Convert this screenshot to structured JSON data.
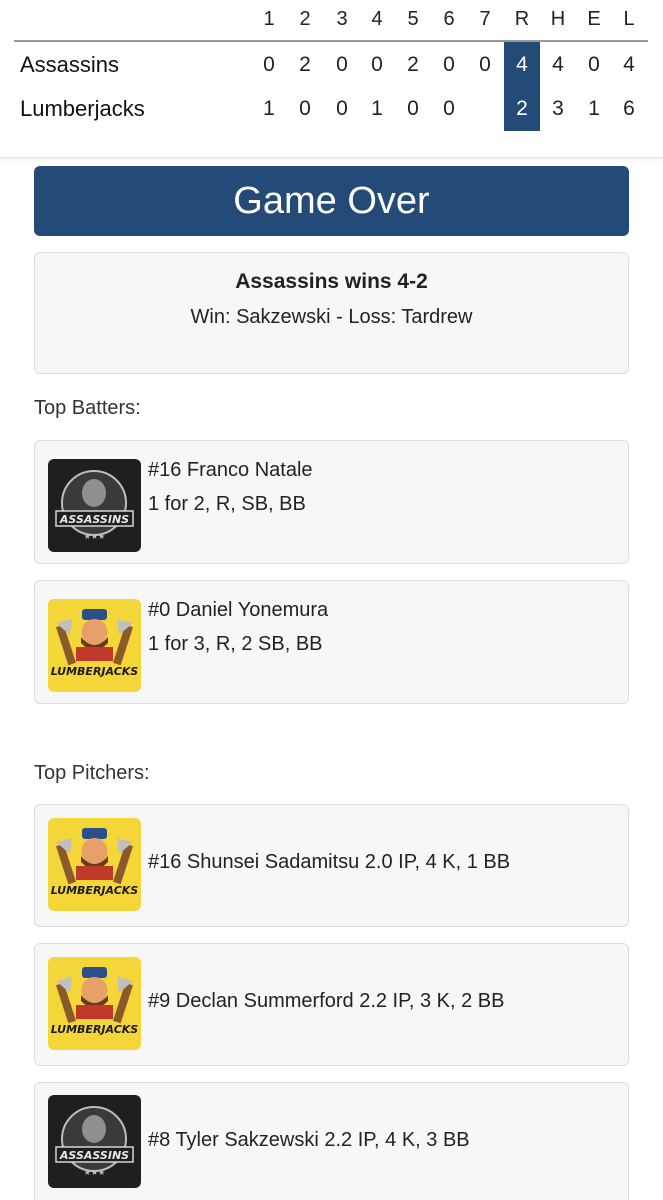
{
  "scoreboard": {
    "headers": [
      "1",
      "2",
      "3",
      "4",
      "5",
      "6",
      "7",
      "R",
      "H",
      "E",
      "L"
    ],
    "teams": [
      {
        "name": "Assassins",
        "cells": [
          "0",
          "2",
          "0",
          "0",
          "2",
          "0",
          "0",
          "4",
          "4",
          "0",
          "4"
        ]
      },
      {
        "name": "Lumberjacks",
        "cells": [
          "1",
          "0",
          "0",
          "1",
          "0",
          "0",
          "",
          "2",
          "3",
          "1",
          "6"
        ]
      }
    ],
    "highlight_color": "#244a77"
  },
  "banner": {
    "text": "Game Over"
  },
  "result": {
    "headline": "Assassins wins 4-2",
    "decision": "Win: Sakzewski - Loss: Tardrew"
  },
  "batters": {
    "label": "Top Batters:",
    "items": [
      {
        "team_logo": "assassins-logo",
        "logo_text": "ASSASSINS",
        "name": "#16 Franco Natale",
        "stats": "1 for 2, R, SB, BB"
      },
      {
        "team_logo": "lumberjacks-logo",
        "logo_text": "LUMBERJACKS",
        "name": "#0 Daniel Yonemura",
        "stats": "1 for 3, R, 2 SB, BB"
      }
    ]
  },
  "pitchers": {
    "label": "Top Pitchers:",
    "items": [
      {
        "team_logo": "lumberjacks-logo",
        "logo_text": "LUMBERJACKS",
        "line": "#16 Shunsei Sadamitsu 2.0 IP, 4 K, 1 BB"
      },
      {
        "team_logo": "lumberjacks-logo",
        "logo_text": "LUMBERJACKS",
        "line": "#9 Declan Summerford 2.2 IP, 3 K, 2 BB"
      },
      {
        "team_logo": "assassins-logo",
        "logo_text": "ASSASSINS",
        "line": "#8 Tyler Sakzewski 2.2 IP, 4 K, 3 BB"
      }
    ]
  },
  "colors": {
    "primary": "#244a77",
    "assassins_logo_bg": "#1f1f1f",
    "lumberjacks_logo_bg": "#f5d638"
  }
}
